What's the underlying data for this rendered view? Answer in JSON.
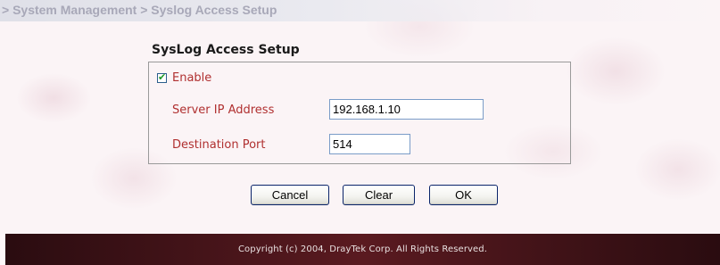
{
  "breadcrumb": "> System Management > Syslog Access Setup",
  "section_title": "SysLog Access Setup",
  "enable": {
    "label": "Enable",
    "checked": true
  },
  "server_ip": {
    "label": "Server IP Address",
    "value": "192.168.1.10"
  },
  "dest_port": {
    "label": "Destination Port",
    "value": "514"
  },
  "buttons": {
    "cancel": "Cancel",
    "clear": "Clear",
    "ok": "OK"
  },
  "footer": {
    "copyright": "Copyright (c) 2004, DrayTek Corp. All Rights Reserved."
  },
  "colors": {
    "label_red": "#b03030",
    "footer_bg": "#5a1a20",
    "breadcrumb_gray": "#a8a8b8"
  }
}
